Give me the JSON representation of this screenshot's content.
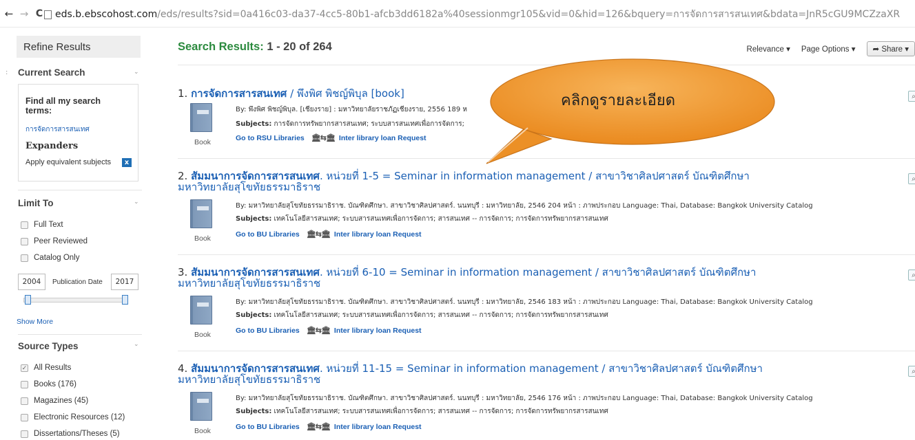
{
  "browser": {
    "url_host": "eds.b.ebscohost.com",
    "url_path": "/eds/results?sid=0a416c03-da37-4cc5-80b1-afcb3dd6182a%40sessionmgr105&vid=0&hid=126&bquery=การจัดการสารสนเทศ&bdata=JnR5cGU9MCZzaXR"
  },
  "sidebar": {
    "edge_glyph": ":",
    "refine_title": "Refine Results",
    "current_search_title": "Current Search",
    "find_all_label": "Find all my search terms:",
    "search_term": "การจัดการสารสนเทศ",
    "expanders_label": "Expanders",
    "apply_label": "Apply equivalent subjects",
    "remove_glyph": "x",
    "limit_title": "Limit To",
    "limits": [
      "Full Text",
      "Peer Reviewed",
      "Catalog Only"
    ],
    "date_from": "2004",
    "date_label": "Publication Date",
    "date_to": "2017",
    "show_more": "Show More",
    "source_title": "Source Types",
    "sources": [
      {
        "label": "All Results",
        "checked": true
      },
      {
        "label": "Books (176)",
        "checked": false
      },
      {
        "label": "Magazines (45)",
        "checked": false
      },
      {
        "label": "Electronic Resources (12)",
        "checked": false
      },
      {
        "label": "Dissertations/Theses (5)",
        "checked": false
      }
    ]
  },
  "header": {
    "results_label": "Search Results:",
    "results_range": "1 - 20 of 264",
    "relevance": "Relevance ▾",
    "page_options": "Page Options ▾",
    "share": "Share ▾"
  },
  "results": [
    {
      "num": "1.",
      "title_hl": "การจัดการสารสนเทศ",
      "title_rest": " / พึงพิศ พิชญ์พิบุล [book]",
      "title_line2": "",
      "by": "By: พึงพิศ พิชญ์พิบุล. [เชียงราย] : มหาวิทยาลัยราชภัฏเชียงราย, 2556 189 ห",
      "subjects_label": "Subjects:",
      "subjects": "การจัดการทรัพยากรสารสนเทศ; ระบบสารสนเทศเพื่อการจัดการ;",
      "link": "Go to RSU Libraries",
      "ill": "Inter library loan Request",
      "type": "Book"
    },
    {
      "num": "2.",
      "title_pre": "สัมมนา",
      "title_hl": "การจัดการสารสนเทศ",
      "title_rest": ". หน่วยที่ 1-5 = Seminar in information management / สาขาวิชาศิลปศาสตร์ บัณฑิตศึกษา",
      "title_line2": "มหาวิทยาลัยสุโขทัยธรรมาธิราช",
      "by": "By: มหาวิทยาลัยสุโขทัยธรรมาธิราช. บัณฑิตศึกษา. สาขาวิชาศิลปศาสตร์. นนทบุรี : มหาวิทยาลัย, 2546 204 หน้า : ภาพประกอบ Language: Thai, Database: Bangkok University Catalog",
      "subjects_label": "Subjects:",
      "subjects": "เทคโนโลยีสารสนเทศ; ระบบสารสนเทศเพื่อการจัดการ; สารสนเทศ -- การจัดการ; การจัดการทรัพยากรสารสนเทศ",
      "link": "Go to BU Libraries",
      "ill": "Inter library loan Request",
      "type": "Book"
    },
    {
      "num": "3.",
      "title_pre": "สัมมนา",
      "title_hl": "การจัดการสารสนเทศ",
      "title_rest": ". หน่วยที่ 6-10 = Seminar in information management / สาขาวิชาศิลปศาสตร์ บัณฑิตศึกษา",
      "title_line2": "มหาวิทยาลัยสุโขทัยธรรมาธิราช",
      "by": "By: มหาวิทยาลัยสุโขทัยธรรมาธิราช. บัณฑิตศึกษา. สาขาวิชาศิลปศาสตร์. นนทบุรี : มหาวิทยาลัย, 2546 183 หน้า : ภาพประกอบ Language: Thai, Database: Bangkok University Catalog",
      "subjects_label": "Subjects:",
      "subjects": "เทคโนโลยีสารสนเทศ; ระบบสารสนเทศเพื่อการจัดการ; สารสนเทศ -- การจัดการ; การจัดการทรัพยากรสารสนเทศ",
      "link": "Go to BU Libraries",
      "ill": "Inter library loan Request",
      "type": "Book"
    },
    {
      "num": "4.",
      "title_pre": "สัมมนา",
      "title_hl": "การจัดการสารสนเทศ",
      "title_rest": ". หน่วยที่ 11-15 = Seminar in information management / สาขาวิชาศิลปศาสตร์ บัณฑิตศึกษา",
      "title_line2": "มหาวิทยาลัยสุโขทัยธรรมาธิราช",
      "by": "By: มหาวิทยาลัยสุโขทัยธรรมาธิราช. บัณฑิตศึกษา. สาขาวิชาศิลปศาสตร์. นนทบุรี : มหาวิทยาลัย, 2546 176 หน้า : ภาพประกอบ Language: Thai, Database: Bangkok University Catalog",
      "subjects_label": "Subjects:",
      "subjects": "เทคโนโลยีสารสนเทศ; ระบบสารสนเทศเพื่อการจัดการ; สารสนเทศ -- การจัดการ; การจัดการทรัพยากรสารสนเทศ",
      "link": "Go to BU Libraries",
      "ill": "Inter library loan Request",
      "type": "Book"
    }
  ],
  "callout": {
    "text": "คลิกดูรายละเอียด"
  },
  "colors": {
    "link": "#1a5fb4",
    "heading_green": "#2b8a3e",
    "callout_orange": "#f0962a"
  }
}
